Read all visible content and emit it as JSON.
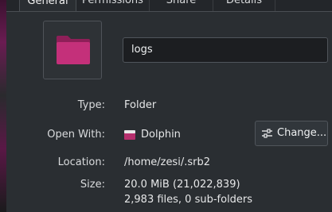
{
  "tabs": [
    {
      "label": "General",
      "active": true
    },
    {
      "label": "Permissions",
      "active": false
    },
    {
      "label": "Share",
      "active": false
    },
    {
      "label": "Details",
      "active": false
    }
  ],
  "folder_icon": {
    "icon": "folder-icon",
    "color": "#c4307a"
  },
  "name_field": {
    "value": "logs"
  },
  "properties": {
    "type": {
      "label": "Type:",
      "value": "Folder"
    },
    "open_with": {
      "label": "Open With:",
      "app": "Dolphin",
      "app_icon": "dolphin-folder-icon"
    },
    "location": {
      "label": "Location:",
      "value": "/home/zesi/.srb2"
    },
    "size": {
      "label": "Size:",
      "value": "20.0 MiB (21,022,839)",
      "detail": "2,983 files, 0 sub-folders"
    }
  },
  "change_button": {
    "label": "Change...",
    "icon": "configure-icon"
  },
  "colors": {
    "panel_bg": "#2a2e32",
    "window_bg": "#1f2124",
    "accent_folder": "#c4307a"
  }
}
